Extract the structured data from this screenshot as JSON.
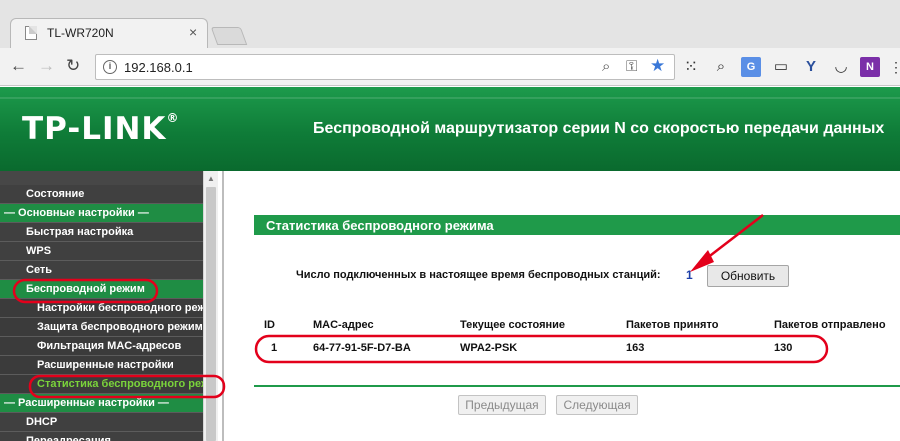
{
  "browser": {
    "tab_title": "TL-WR720N",
    "tab_close": "×",
    "url": "192.168.0.1",
    "nav": {
      "back": "←",
      "forward": "→",
      "reload": "↻"
    },
    "icons": [
      "info-icon",
      "zoom-icon",
      "key-icon",
      "bookmark-star-icon",
      "apps-icon",
      "search-icon",
      "translate-icon",
      "reader-icon",
      "yandex-icon",
      "pocket-icon",
      "onenote-icon"
    ]
  },
  "header": {
    "logo": "TP-LINK",
    "logo_mark": "®",
    "title": "Беспроводной маршрутизатор серии N со скоростью передачи данных"
  },
  "sidebar": {
    "items": [
      {
        "label": "Состояние"
      },
      {
        "label": "— Основные настройки —"
      },
      {
        "label": "Быстрая настройка"
      },
      {
        "label": "WPS"
      },
      {
        "label": "Сеть"
      },
      {
        "label": "Беспроводной режим"
      },
      {
        "label": "Настройки беспроводного режима"
      },
      {
        "label": "Защита беспроводного режима"
      },
      {
        "label": "Фильтрация MAC-адресов"
      },
      {
        "label": "Расширенные настройки"
      },
      {
        "label": "Статистика беспроводного режима"
      },
      {
        "label": "— Расширенные настройки —"
      },
      {
        "label": "DHCP"
      },
      {
        "label": "Переадресация"
      }
    ]
  },
  "main": {
    "section_title": "Статистика беспроводного режима",
    "stations_label": "Число подключенных в настоящее время беспроводных станций:",
    "stations_count": "1",
    "refresh_button": "Обновить",
    "table": {
      "headers": [
        "ID",
        "MAC-адрес",
        "Текущее состояние",
        "Пакетов принято",
        "Пакетов отправлено"
      ],
      "rows": [
        [
          "1",
          "64-77-91-5F-D7-BA",
          "WPA2-PSK",
          "163",
          "130"
        ]
      ]
    },
    "prev_button": "Предыдущая",
    "next_button": "Следующая"
  },
  "annotation_color": "#e3001b",
  "brand_green": "#1f9a4a"
}
